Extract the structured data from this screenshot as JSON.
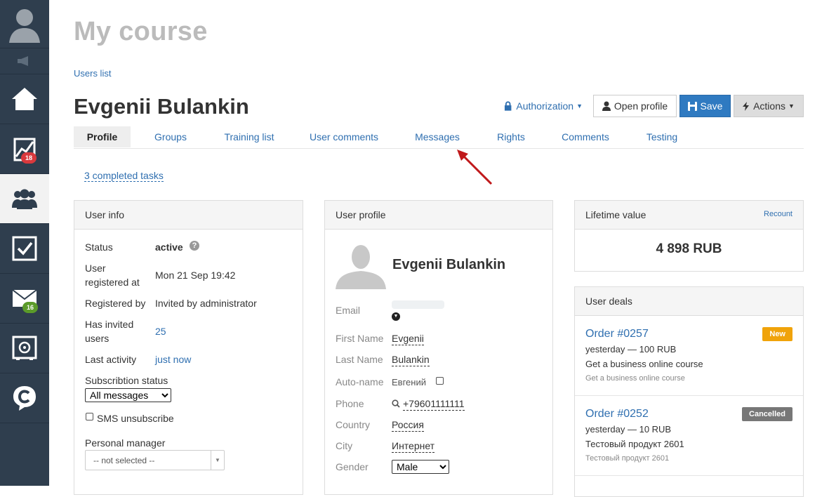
{
  "sidebar": {
    "badges": {
      "reports": "18",
      "mail": "16"
    }
  },
  "page": {
    "title": "My course",
    "breadcrumb": "Users list",
    "user_name": "Evgenii Bulankin"
  },
  "toolbar": {
    "authorization": "Authorization",
    "open_profile": "Open profile",
    "save": "Save",
    "actions": "Actions"
  },
  "tabs": [
    "Profile",
    "Groups",
    "Training list",
    "User comments",
    "Messages",
    "Rights",
    "Comments",
    "Testing"
  ],
  "completed_tasks": "3 completed tasks",
  "user_info": {
    "title": "User info",
    "status_label": "Status",
    "status_value": "active",
    "registered_at_label_1": "User",
    "registered_at_label_2": "registered at",
    "registered_at_value": "Mon 21 Sep 19:42",
    "registered_by_label": "Registered by",
    "registered_by_value": "Invited by administrator",
    "invited_label_1": "Has invited",
    "invited_label_2": "users",
    "invited_value": "25",
    "last_activity_label": "Last activity",
    "last_activity_value": "just now",
    "subscription_label": "Subscribtion status",
    "subscription_value": "All messages",
    "sms_label": "SMS unsubscribe",
    "manager_label": "Personal manager",
    "manager_value": "-- not selected --"
  },
  "user_profile": {
    "title": "User profile",
    "name": "Evgenii Bulankin",
    "email_label": "Email",
    "first_name_label": "First Name",
    "first_name": "Evgenii",
    "last_name_label": "Last Name",
    "last_name": "Bulankin",
    "autoname_label": "Auto-name",
    "autoname_value": "Евгений",
    "phone_label": "Phone",
    "phone": "+79601111111",
    "country_label": "Country",
    "country": "Россия",
    "city_label": "City",
    "city": "Интернет",
    "gender_label": "Gender",
    "gender": "Male"
  },
  "lifetime": {
    "title": "Lifetime value",
    "recount": "Recount",
    "value": "4 898 RUB"
  },
  "deals": {
    "title": "User deals",
    "items": [
      {
        "order": "Order #0257",
        "meta": "yesterday — 100 RUB",
        "product": "Get a business online course",
        "sub": "Get a business online course",
        "status": "New",
        "status_color": "#f0a30a"
      },
      {
        "order": "Order #0252",
        "meta": "yesterday — 10 RUB",
        "product": "Тестовый продукт 2601",
        "sub": "Тестовый продукт 2601",
        "status": "Cancelled",
        "status_color": "#777777"
      }
    ]
  }
}
